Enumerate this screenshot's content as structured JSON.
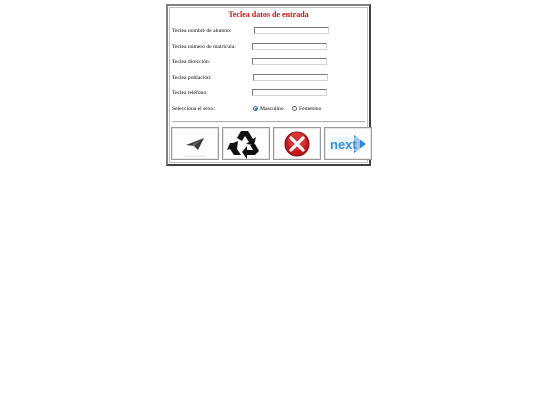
{
  "form": {
    "title": "Teclea datos de entrada",
    "fields": [
      {
        "label": "Teclea nombre de alumno:",
        "value": ""
      },
      {
        "label": "Teclea número de matrícula:",
        "value": ""
      },
      {
        "label": "Teclea dirección:",
        "value": ""
      },
      {
        "label": "Teclea población:",
        "value": ""
      },
      {
        "label": "Teclea teléfono:",
        "value": ""
      }
    ],
    "sex": {
      "label": "Selecciona el sexo:",
      "options": [
        "Masculino",
        "Femenino"
      ],
      "selected": "Masculino"
    }
  },
  "buttons": {
    "send_icon": "paper-plane-icon",
    "reset_icon": "recycle-icon",
    "cancel_icon": "red-x-icon",
    "next_label": "next",
    "accent_red": "#cc1111",
    "next_color": "#3b8fd9"
  }
}
